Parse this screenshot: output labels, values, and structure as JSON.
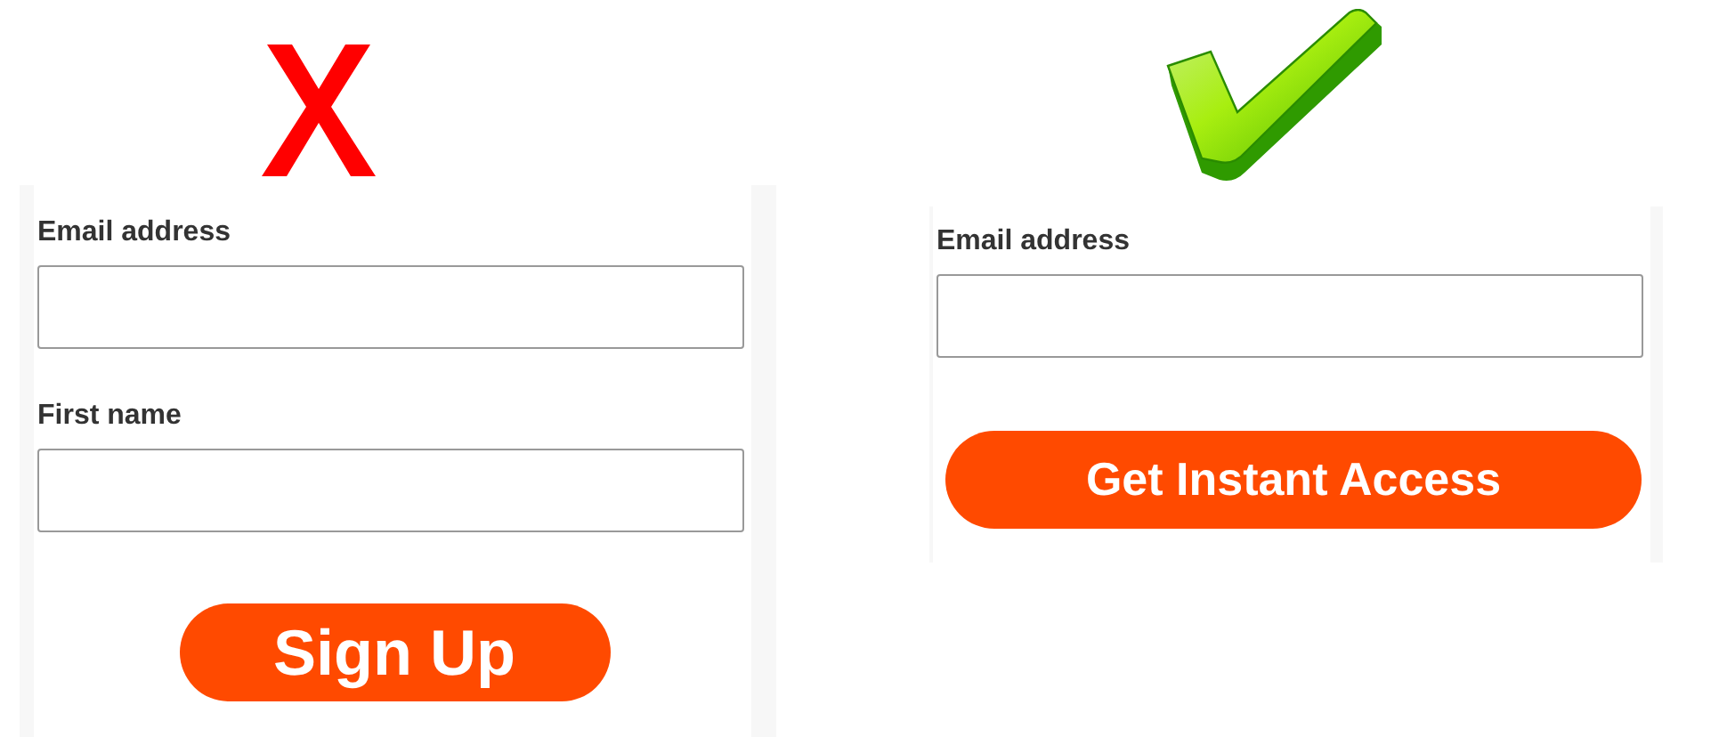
{
  "panels": [
    {
      "kind": "bad",
      "fields": [
        {
          "label": "Email address"
        },
        {
          "label": "First name"
        }
      ],
      "button": "Sign Up"
    },
    {
      "kind": "good",
      "fields": [
        {
          "label": "Email address"
        }
      ],
      "button": "Get Instant Access"
    }
  ]
}
